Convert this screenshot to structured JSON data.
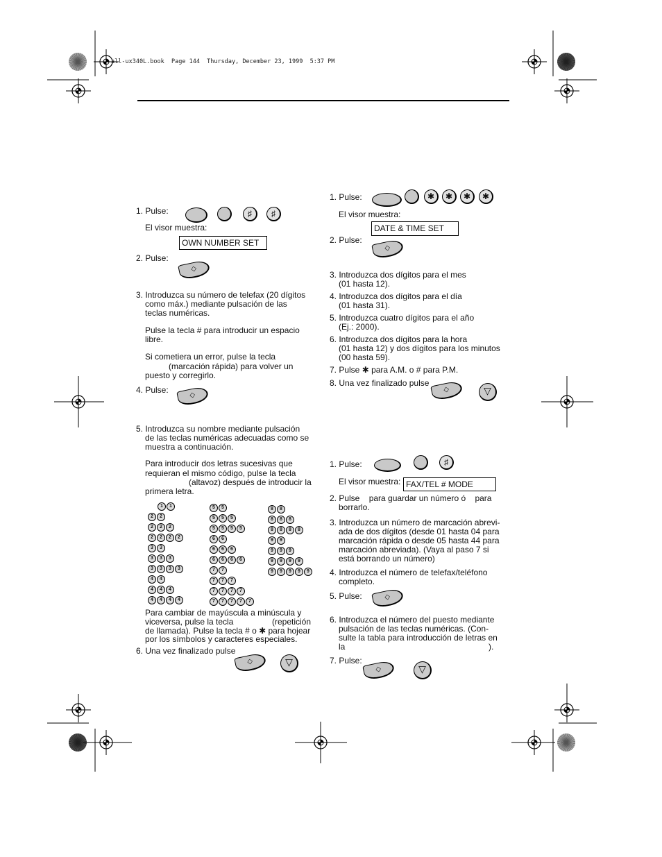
{
  "header": {
    "file_info": "all-ux340L.book  Page 144  Thursday, December 23, 1999  5:37 PM"
  },
  "left": {
    "s1": "1. Pulse:",
    "visor": "El visor muestra:",
    "display1": "OWN NUMBER SET",
    "s2": "2. Pulse:",
    "s3": [
      "3. Introduzca su número de telefax (20 dígitos",
      "como máx.) mediante pulsación de las",
      "teclas numéricas."
    ],
    "s3b": [
      "Pulse la tecla # para introducir un espacio",
      "libre."
    ],
    "s3c": [
      "Si cometiera un error, pulse la tecla",
      "(marcación rápida) para volver un",
      "puesto y corregirlo."
    ],
    "s4": "4. Pulse:",
    "s5": [
      "5. Introduzca su nombre mediante pulsación",
      "de las teclas numéricas adecuadas como se",
      "muestra a continuación."
    ],
    "s5b": [
      "Para introducir dos letras sucesivas que",
      "requieran el mismo código, pulse la tecla",
      "(altavoz) después de introducir la",
      "primera letra."
    ],
    "grid": [
      [
        "11",
        "22",
        "222",
        "2222",
        "33",
        "333",
        "3333",
        "44",
        "444",
        "4444"
      ],
      [
        "55",
        "555",
        "5555",
        "66",
        "666",
        "6666",
        "77",
        "777",
        "7777",
        "77777"
      ],
      [
        "88",
        "888",
        "8888",
        "99",
        "999",
        "9999",
        "99999"
      ]
    ],
    "s5c": [
      "Para cambiar de mayúscula a minúscula y",
      "viceversa, pulse la tecla",
      "(repetición",
      "de llamada). Pulse la tecla # o ✱ para hojear",
      "por los símbolos y caracteres especiales."
    ],
    "s6": "6. Una vez finalizado pulse"
  },
  "right": {
    "a1": "1. Pulse:",
    "visor": "El visor muestra:",
    "display1": "DATE & TIME SET",
    "a2": "2. Pulse:",
    "a3": [
      "3. Introduzca dos dígitos para el mes",
      "(01 hasta 12)."
    ],
    "a4": [
      "4. Introduzca dos dígitos para el día",
      "(01 hasta 31)."
    ],
    "a5": [
      "5. Introduzca cuatro dígitos para el año",
      "(Ej.: 2000)."
    ],
    "a6": [
      "6. Introduzca dos dígitos para la hora",
      "(01 hasta 12) y dos dígitos para los minutos",
      "(00 hasta 59)."
    ],
    "a7": "7. Pulse ✱ para A.M. o # para P.M.",
    "a8": "8. Una vez finalizado pulse",
    "b1": "1. Pulse:",
    "display2": "FAX/TEL # MODE",
    "b2": [
      "2. Pulse    para guardar un número ó    para",
      "borrarlo."
    ],
    "b3": [
      "3. Introduzca un número de marcación abrevi-",
      "ada de dos dígitos (desde 01 hasta 04 para",
      "marcación rápida o desde 05 hasta 44 para",
      "marcación abreviada). (Vaya al paso 7 si",
      "está borrando un número)"
    ],
    "b4": [
      "4. Introduzca el número de telefax/teléfono",
      "completo."
    ],
    "b5": "5. Pulse:",
    "b6": [
      "6. Introduzca el número del puesto mediante",
      "pulsación de las teclas numéricas. (Con-",
      "sulte la tabla para introducción de letras en",
      "la",
      ")."
    ],
    "b7": "7. Pulse:"
  },
  "keys": {
    "hash": "♯",
    "star": "✱",
    "start": "◇",
    "stop": "▽"
  }
}
